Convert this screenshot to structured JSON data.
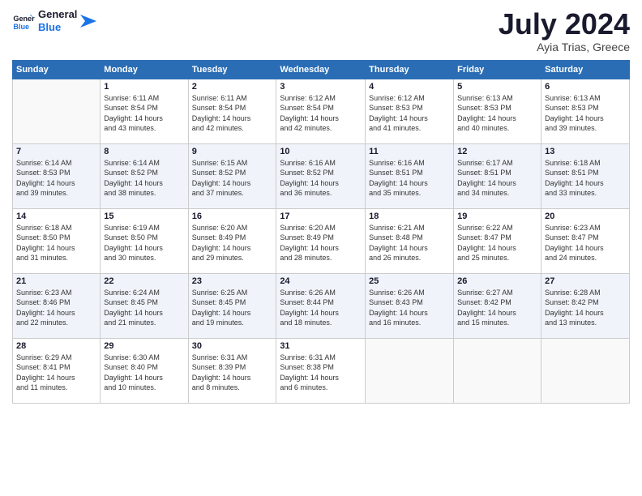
{
  "logo": {
    "line1": "General",
    "line2": "Blue"
  },
  "title": "July 2024",
  "location": "Ayia Trias, Greece",
  "weekdays": [
    "Sunday",
    "Monday",
    "Tuesday",
    "Wednesday",
    "Thursday",
    "Friday",
    "Saturday"
  ],
  "weeks": [
    [
      {
        "day": "",
        "info": ""
      },
      {
        "day": "1",
        "info": "Sunrise: 6:11 AM\nSunset: 8:54 PM\nDaylight: 14 hours\nand 43 minutes."
      },
      {
        "day": "2",
        "info": "Sunrise: 6:11 AM\nSunset: 8:54 PM\nDaylight: 14 hours\nand 42 minutes."
      },
      {
        "day": "3",
        "info": "Sunrise: 6:12 AM\nSunset: 8:54 PM\nDaylight: 14 hours\nand 42 minutes."
      },
      {
        "day": "4",
        "info": "Sunrise: 6:12 AM\nSunset: 8:53 PM\nDaylight: 14 hours\nand 41 minutes."
      },
      {
        "day": "5",
        "info": "Sunrise: 6:13 AM\nSunset: 8:53 PM\nDaylight: 14 hours\nand 40 minutes."
      },
      {
        "day": "6",
        "info": "Sunrise: 6:13 AM\nSunset: 8:53 PM\nDaylight: 14 hours\nand 39 minutes."
      }
    ],
    [
      {
        "day": "7",
        "info": "Sunrise: 6:14 AM\nSunset: 8:53 PM\nDaylight: 14 hours\nand 39 minutes."
      },
      {
        "day": "8",
        "info": "Sunrise: 6:14 AM\nSunset: 8:52 PM\nDaylight: 14 hours\nand 38 minutes."
      },
      {
        "day": "9",
        "info": "Sunrise: 6:15 AM\nSunset: 8:52 PM\nDaylight: 14 hours\nand 37 minutes."
      },
      {
        "day": "10",
        "info": "Sunrise: 6:16 AM\nSunset: 8:52 PM\nDaylight: 14 hours\nand 36 minutes."
      },
      {
        "day": "11",
        "info": "Sunrise: 6:16 AM\nSunset: 8:51 PM\nDaylight: 14 hours\nand 35 minutes."
      },
      {
        "day": "12",
        "info": "Sunrise: 6:17 AM\nSunset: 8:51 PM\nDaylight: 14 hours\nand 34 minutes."
      },
      {
        "day": "13",
        "info": "Sunrise: 6:18 AM\nSunset: 8:51 PM\nDaylight: 14 hours\nand 33 minutes."
      }
    ],
    [
      {
        "day": "14",
        "info": "Sunrise: 6:18 AM\nSunset: 8:50 PM\nDaylight: 14 hours\nand 31 minutes."
      },
      {
        "day": "15",
        "info": "Sunrise: 6:19 AM\nSunset: 8:50 PM\nDaylight: 14 hours\nand 30 minutes."
      },
      {
        "day": "16",
        "info": "Sunrise: 6:20 AM\nSunset: 8:49 PM\nDaylight: 14 hours\nand 29 minutes."
      },
      {
        "day": "17",
        "info": "Sunrise: 6:20 AM\nSunset: 8:49 PM\nDaylight: 14 hours\nand 28 minutes."
      },
      {
        "day": "18",
        "info": "Sunrise: 6:21 AM\nSunset: 8:48 PM\nDaylight: 14 hours\nand 26 minutes."
      },
      {
        "day": "19",
        "info": "Sunrise: 6:22 AM\nSunset: 8:47 PM\nDaylight: 14 hours\nand 25 minutes."
      },
      {
        "day": "20",
        "info": "Sunrise: 6:23 AM\nSunset: 8:47 PM\nDaylight: 14 hours\nand 24 minutes."
      }
    ],
    [
      {
        "day": "21",
        "info": "Sunrise: 6:23 AM\nSunset: 8:46 PM\nDaylight: 14 hours\nand 22 minutes."
      },
      {
        "day": "22",
        "info": "Sunrise: 6:24 AM\nSunset: 8:45 PM\nDaylight: 14 hours\nand 21 minutes."
      },
      {
        "day": "23",
        "info": "Sunrise: 6:25 AM\nSunset: 8:45 PM\nDaylight: 14 hours\nand 19 minutes."
      },
      {
        "day": "24",
        "info": "Sunrise: 6:26 AM\nSunset: 8:44 PM\nDaylight: 14 hours\nand 18 minutes."
      },
      {
        "day": "25",
        "info": "Sunrise: 6:26 AM\nSunset: 8:43 PM\nDaylight: 14 hours\nand 16 minutes."
      },
      {
        "day": "26",
        "info": "Sunrise: 6:27 AM\nSunset: 8:42 PM\nDaylight: 14 hours\nand 15 minutes."
      },
      {
        "day": "27",
        "info": "Sunrise: 6:28 AM\nSunset: 8:42 PM\nDaylight: 14 hours\nand 13 minutes."
      }
    ],
    [
      {
        "day": "28",
        "info": "Sunrise: 6:29 AM\nSunset: 8:41 PM\nDaylight: 14 hours\nand 11 minutes."
      },
      {
        "day": "29",
        "info": "Sunrise: 6:30 AM\nSunset: 8:40 PM\nDaylight: 14 hours\nand 10 minutes."
      },
      {
        "day": "30",
        "info": "Sunrise: 6:31 AM\nSunset: 8:39 PM\nDaylight: 14 hours\nand 8 minutes."
      },
      {
        "day": "31",
        "info": "Sunrise: 6:31 AM\nSunset: 8:38 PM\nDaylight: 14 hours\nand 6 minutes."
      },
      {
        "day": "",
        "info": ""
      },
      {
        "day": "",
        "info": ""
      },
      {
        "day": "",
        "info": ""
      }
    ]
  ]
}
